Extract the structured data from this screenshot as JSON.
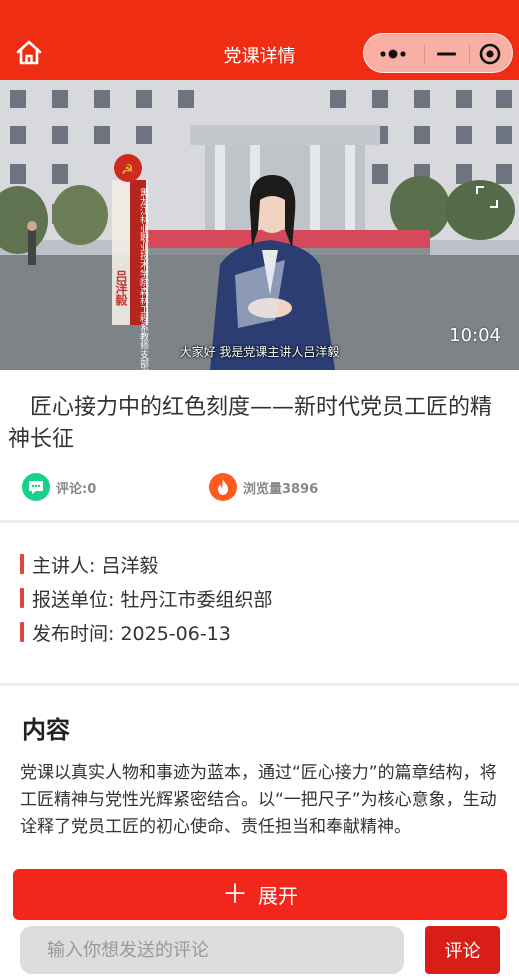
{
  "header": {
    "title": "党课详情",
    "home_icon": "home-icon",
    "capsule": {
      "more_icon": "more-dots-icon",
      "minimize_icon": "minimize-icon",
      "close_icon": "target-close-icon"
    },
    "colors": {
      "background": "#ee2d12"
    }
  },
  "video": {
    "subtitle": "大家好  我是党课主讲人吕洋毅",
    "duration": "10:04",
    "sign_text": "黑龙江林业职业技术学院森林工程系教师支部书记",
    "sign_name": "吕洋毅",
    "fullscreen_icon": "fullscreen-icon"
  },
  "article": {
    "title": "匠心接力中的红色刻度——新时代党员工匠的精神长征",
    "comments_label": "评论:0",
    "views_label": "浏览量3896",
    "comment_icon": "comment-icon",
    "views_icon": "fire-icon",
    "colors": {
      "comment_icon_bg": "#18d18a",
      "views_icon_bg": "#ff5a1f"
    }
  },
  "info": {
    "speaker": "主讲人: 吕洋毅",
    "unit": "报送单位: 牡丹江市委组织部",
    "date": "发布时间: 2025-06-13",
    "colors": {
      "bar": "#e0453c"
    }
  },
  "content": {
    "heading": "内容",
    "text": "党课以真实人物和事迹为蓝本，通过“匠心接力”的篇章结构，将工匠精神与党性光辉紧密结合。以“一把尺子”为核心意象，生动诠释了党员工匠的初心使命、责任担当和奉献精神。"
  },
  "actions": {
    "expand_label": "展开",
    "expand_icon": "plus-icon",
    "comment_placeholder": "输入你想发送的评论",
    "comment_button": "评论",
    "colors": {
      "expand": "#f3261c",
      "comment_button": "#d81e17"
    }
  }
}
